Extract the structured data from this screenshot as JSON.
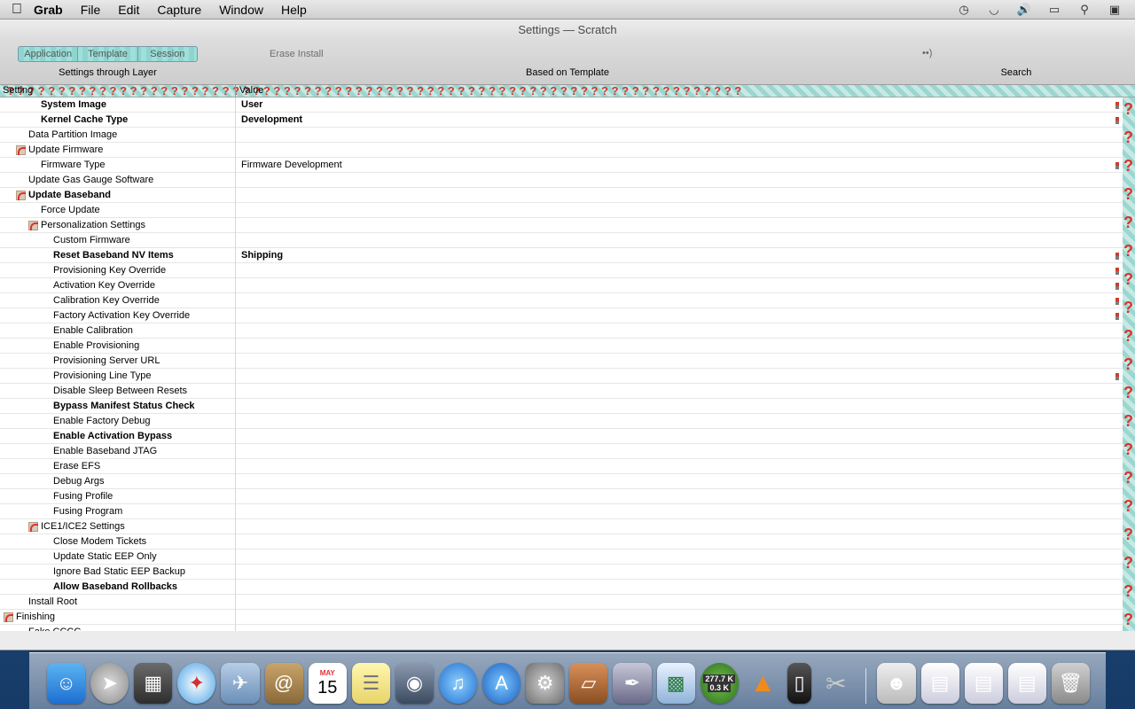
{
  "menubar": {
    "apple": "",
    "app_name": "Grab",
    "items": [
      "File",
      "Edit",
      "Capture",
      "Window",
      "Help"
    ]
  },
  "window": {
    "title": "Settings — Scratch"
  },
  "toolbar": {
    "segments": [
      "Application",
      "Template",
      "Session"
    ],
    "segments_label": "Settings through Layer",
    "erase_install": "Erase Install",
    "template_label": "Based on Template",
    "search_control": "••)",
    "search_label": "Search"
  },
  "table": {
    "col_setting": "Setting",
    "col_value": "Value",
    "rows": [
      {
        "name": "System Image",
        "value": "User",
        "level": 3,
        "bold": true,
        "disc": false,
        "marker": true
      },
      {
        "name": "Kernel Cache Type",
        "value": "Development",
        "level": 3,
        "bold": true,
        "disc": false,
        "marker": true
      },
      {
        "name": "Data Partition Image",
        "value": "",
        "level": 2,
        "bold": false,
        "disc": false,
        "marker": false
      },
      {
        "name": "Update Firmware",
        "value": "",
        "level": 2,
        "bold": false,
        "disc": true,
        "marker": false
      },
      {
        "name": "Firmware Type",
        "value": "Firmware Development",
        "level": 3,
        "bold": false,
        "disc": false,
        "marker": true
      },
      {
        "name": "Update Gas Gauge Software",
        "value": "",
        "level": 2,
        "bold": false,
        "disc": false,
        "marker": false
      },
      {
        "name": "Update Baseband",
        "value": "",
        "level": 2,
        "bold": true,
        "disc": true,
        "marker": false
      },
      {
        "name": "Force Update",
        "value": "",
        "level": 3,
        "bold": false,
        "disc": false,
        "marker": false
      },
      {
        "name": "Personalization Settings",
        "value": "",
        "level": 3,
        "bold": false,
        "disc": true,
        "marker": false
      },
      {
        "name": "Custom Firmware",
        "value": "",
        "level": 4,
        "bold": false,
        "disc": false,
        "marker": false
      },
      {
        "name": "Reset Baseband NV Items",
        "value": "Shipping",
        "level": 4,
        "bold": true,
        "disc": false,
        "marker": true
      },
      {
        "name": "Provisioning Key Override",
        "value": "",
        "level": 4,
        "bold": false,
        "disc": false,
        "marker": true
      },
      {
        "name": "Activation Key Override",
        "value": "",
        "level": 4,
        "bold": false,
        "disc": false,
        "marker": true
      },
      {
        "name": "Calibration Key Override",
        "value": "",
        "level": 4,
        "bold": false,
        "disc": false,
        "marker": true
      },
      {
        "name": "Factory Activation Key Override",
        "value": "",
        "level": 4,
        "bold": false,
        "disc": false,
        "marker": true
      },
      {
        "name": "Enable Calibration",
        "value": "",
        "level": 4,
        "bold": false,
        "disc": false,
        "marker": false
      },
      {
        "name": "Enable Provisioning",
        "value": "",
        "level": 4,
        "bold": false,
        "disc": false,
        "marker": false
      },
      {
        "name": "Provisioning Server URL",
        "value": "",
        "level": 4,
        "bold": false,
        "disc": false,
        "marker": false
      },
      {
        "name": "Provisioning Line Type",
        "value": "",
        "level": 4,
        "bold": false,
        "disc": false,
        "marker": true
      },
      {
        "name": "Disable Sleep Between Resets",
        "value": "",
        "level": 4,
        "bold": false,
        "disc": false,
        "marker": false
      },
      {
        "name": "Bypass Manifest Status Check",
        "value": "",
        "level": 4,
        "bold": true,
        "disc": false,
        "marker": false
      },
      {
        "name": "Enable Factory Debug",
        "value": "",
        "level": 4,
        "bold": false,
        "disc": false,
        "marker": false
      },
      {
        "name": "Enable Activation Bypass",
        "value": "",
        "level": 4,
        "bold": true,
        "disc": false,
        "marker": false
      },
      {
        "name": "Enable Baseband JTAG",
        "value": "",
        "level": 4,
        "bold": false,
        "disc": false,
        "marker": false
      },
      {
        "name": "Erase EFS",
        "value": "",
        "level": 4,
        "bold": false,
        "disc": false,
        "marker": false
      },
      {
        "name": "Debug Args",
        "value": "",
        "level": 4,
        "bold": false,
        "disc": false,
        "marker": false
      },
      {
        "name": "Fusing Profile",
        "value": "",
        "level": 4,
        "bold": false,
        "disc": false,
        "marker": false
      },
      {
        "name": "Fusing Program",
        "value": "",
        "level": 4,
        "bold": false,
        "disc": false,
        "marker": false
      },
      {
        "name": "ICE1/ICE2 Settings",
        "value": "",
        "level": 3,
        "bold": false,
        "disc": true,
        "marker": false
      },
      {
        "name": "Close Modem Tickets",
        "value": "",
        "level": 4,
        "bold": false,
        "disc": false,
        "marker": false
      },
      {
        "name": "Update Static EEP Only",
        "value": "",
        "level": 4,
        "bold": false,
        "disc": false,
        "marker": false
      },
      {
        "name": "Ignore Bad Static EEP Backup",
        "value": "",
        "level": 4,
        "bold": false,
        "disc": false,
        "marker": false
      },
      {
        "name": "Allow Baseband Rollbacks",
        "value": "",
        "level": 4,
        "bold": true,
        "disc": false,
        "marker": false
      },
      {
        "name": "Install Root",
        "value": "",
        "level": 2,
        "bold": false,
        "disc": false,
        "marker": false
      },
      {
        "name": "Finishing",
        "value": "",
        "level": 1,
        "bold": false,
        "disc": true,
        "marker": false
      },
      {
        "name": "Fake CCCC",
        "value": "",
        "level": 2,
        "bold": false,
        "disc": false,
        "marker": false
      }
    ]
  },
  "dock": {
    "download_badge_top": "277.7 K",
    "download_badge_bottom": "0.3 K",
    "calendar_month": "MAY",
    "calendar_day": "15",
    "items": [
      "finder-icon",
      "launchpad-icon",
      "photo-booth-icon",
      "safari-icon",
      "mail-icon",
      "contacts-icon",
      "calendar-icon",
      "notes-icon",
      "facetime-icon",
      "itunes-icon",
      "app-store-icon",
      "system-preferences-icon",
      "keynote-icon",
      "script-editor-icon",
      "numbers-icon",
      "download-meter-icon",
      "vlc-icon",
      "iphone-config-icon",
      "scissors-icon"
    ]
  },
  "colors": {
    "accent_red": "#d8332a",
    "stripe_teal": "#9bd6d0"
  }
}
